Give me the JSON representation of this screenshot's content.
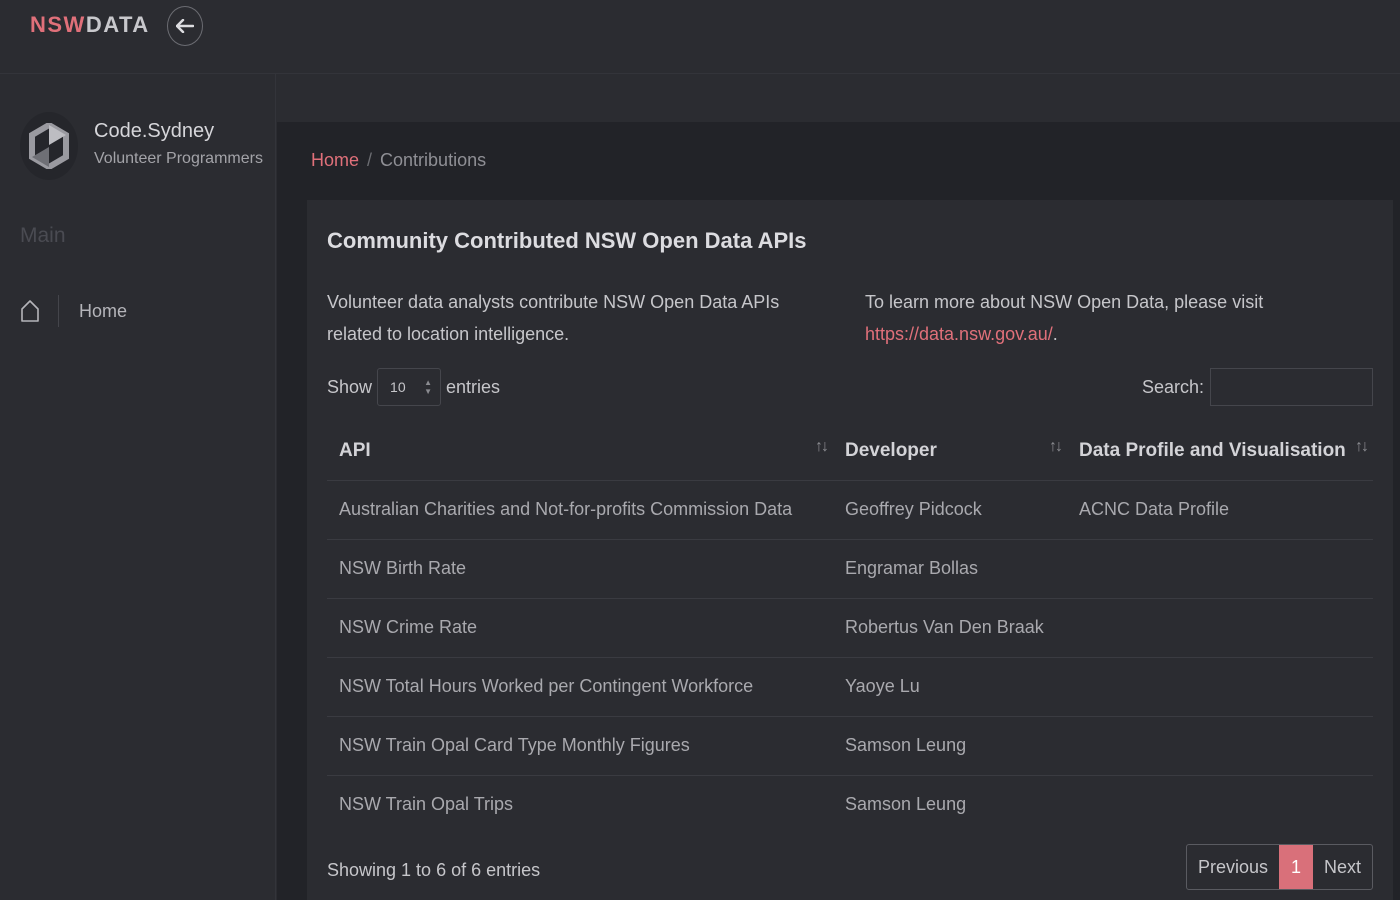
{
  "header": {
    "brand_nsw": "NSW",
    "brand_data": "DATA",
    "back_icon": "arrow-left-icon"
  },
  "sidebar": {
    "org_name": "Code.Sydney",
    "org_subtitle": "Volunteer Programmers",
    "section_title": "Main",
    "items": [
      {
        "label": "Home",
        "icon": "home-icon"
      }
    ]
  },
  "breadcrumb": {
    "home": "Home",
    "separator": "/",
    "current": "Contributions"
  },
  "card": {
    "title": "Community Contributed NSW Open Data APIs",
    "intro_left": "Volunteer data analysts contribute NSW Open Data APIs related to location intelligence.",
    "intro_right_text": "To learn more about NSW Open Data, please visit",
    "intro_right_link": "https://data.nsw.gov.au/",
    "intro_right_end": "."
  },
  "table_controls": {
    "show_label": "Show",
    "entries_label": "entries",
    "page_length": "10",
    "search_label": "Search:",
    "search_value": ""
  },
  "table": {
    "columns": [
      "API",
      "Developer",
      "Data Profile and Visualisation"
    ],
    "rows": [
      [
        "Australian Charities and Not-for-profits Commission Data",
        "Geoffrey Pidcock",
        "ACNC Data Profile"
      ],
      [
        "NSW Birth Rate",
        "Engramar Bollas",
        ""
      ],
      [
        "NSW Crime Rate",
        "Robertus Van Den Braak",
        ""
      ],
      [
        "NSW Total Hours Worked per Contingent Workforce",
        "Yaoye Lu",
        ""
      ],
      [
        "NSW Train Opal Card Type Monthly Figures",
        "Samson Leung",
        ""
      ],
      [
        "NSW Train Opal Trips",
        "Samson Leung",
        ""
      ]
    ]
  },
  "footer": {
    "info": "Showing 1 to 6 of 6 entries",
    "previous": "Previous",
    "current_page": "1",
    "next": "Next"
  },
  "colors": {
    "accent": "#e0707a",
    "background": "#2b2c31",
    "content_background": "#222328"
  }
}
